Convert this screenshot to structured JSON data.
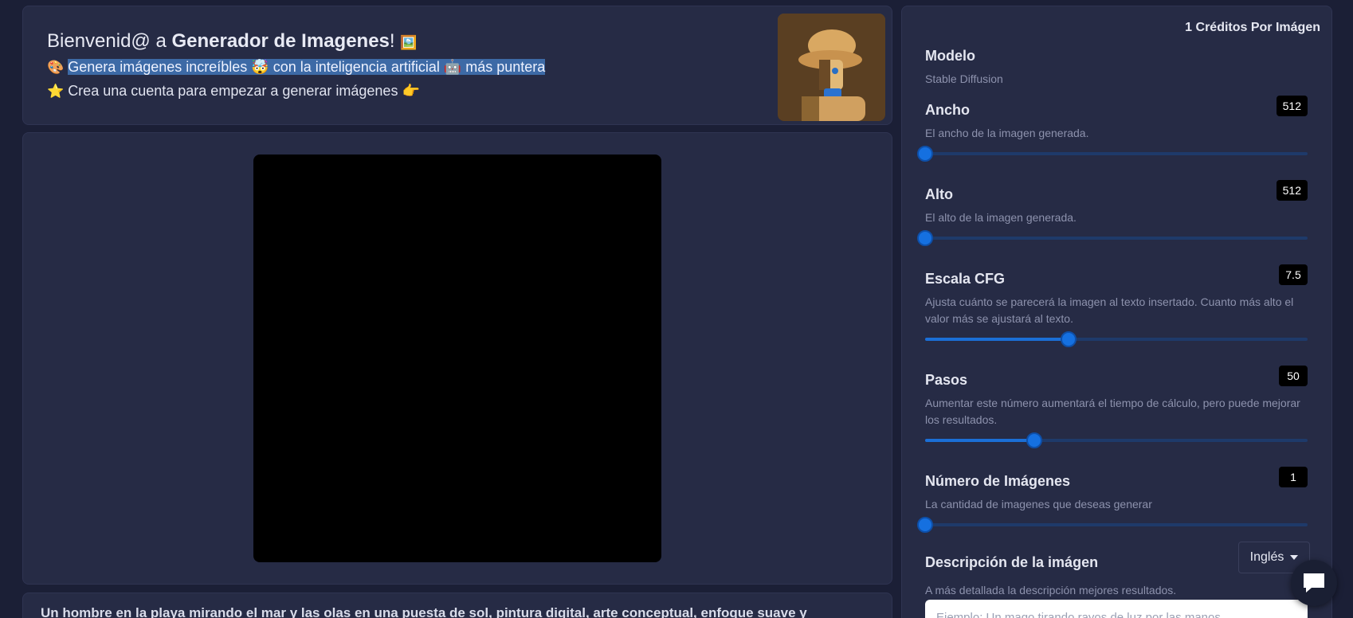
{
  "header": {
    "welcome_prefix": "Bienvenid@ a ",
    "app_name": "Generador de Imagenes",
    "welcome_suffix": "!",
    "welcome_emoji": "🖼️",
    "line1_emoji": "🎨",
    "line1_text": "Genera imágenes increíbles 🤯 con la inteligencia artificial 🤖 más puntera",
    "line2_emoji": "⭐",
    "line2_text": "Crea una cuenta para empezar a generar imágenes 👉"
  },
  "prompt": {
    "text": "Un hombre en la playa mirando el mar y las olas en una puesta de sol, pintura digital, arte conceptual, enfoque suave y"
  },
  "settings": {
    "credits": "1 Créditos Por Imágen",
    "model": {
      "label": "Modelo",
      "value": "Stable Diffusion"
    },
    "width": {
      "label": "Ancho",
      "desc": "El ancho de la imagen generada.",
      "value": "512",
      "fraction": 0.0
    },
    "height": {
      "label": "Alto",
      "desc": "El alto de la imagen generada.",
      "value": "512",
      "fraction": 0.0
    },
    "cfg": {
      "label": "Escala CFG",
      "desc": "Ajusta cuánto se parecerá la imagen al texto insertado. Cuanto más alto el valor más se ajustará al texto.",
      "value": "7.5",
      "fraction": 0.375
    },
    "steps": {
      "label": "Pasos",
      "desc": "Aumentar este número aumentará el tiempo de cálculo, pero puede mejorar los resultados.",
      "value": "50",
      "fraction": 0.286
    },
    "num_images": {
      "label": "Número de Imágenes",
      "desc": "La cantidad de imagenes que deseas generar",
      "value": "1",
      "fraction": 0.0
    },
    "description": {
      "label": "Descripción de la imágen",
      "desc": "A más detallada la descripción mejores resultados.",
      "language": "Inglés",
      "placeholder": "Ejemplo: Un mago tirando rayos de luz por las manos"
    }
  },
  "icons": {
    "chat": "chat-bubble-icon",
    "caret": "caret-down-icon"
  }
}
